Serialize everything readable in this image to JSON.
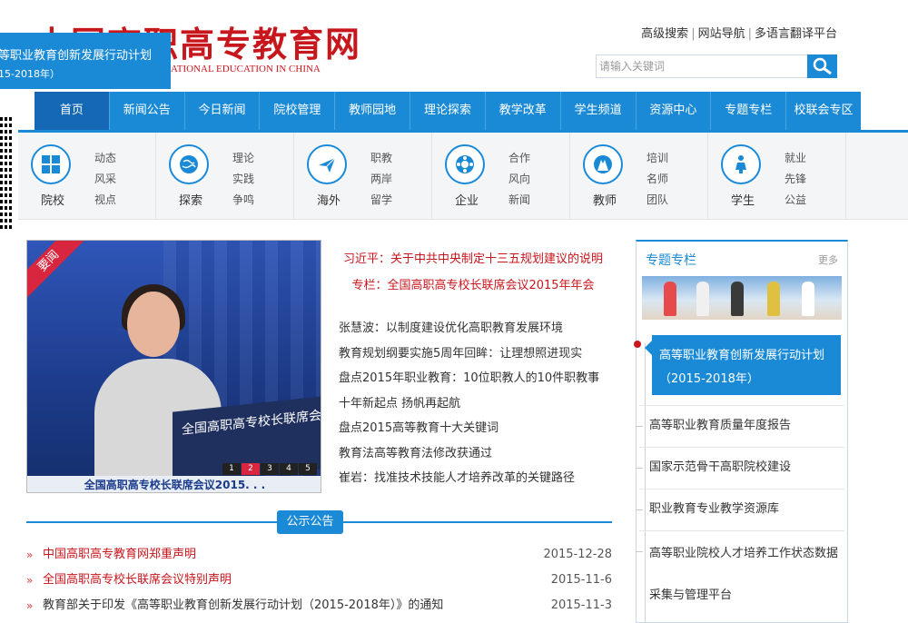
{
  "header": {
    "logo_cn": "中国高职高专教育网",
    "logo_en": "ATIONAL EDUCATION IN CHINA",
    "toplinks": [
      "高级搜索",
      "网站导航",
      "多语言翻译平台"
    ],
    "search_placeholder": "请输入关键词"
  },
  "float_banner": {
    "line1": "等职业教育创新发展行动计划",
    "line2": "15-2018年）"
  },
  "nav": [
    "首页",
    "新闻公告",
    "今日新闻",
    "院校管理",
    "教师园地",
    "理论探索",
    "教学改革",
    "学生频道",
    "资源中心",
    "专题专栏",
    "校联会专区"
  ],
  "categories": [
    {
      "name": "院校",
      "links": [
        "动态",
        "风采",
        "视点"
      ]
    },
    {
      "name": "探索",
      "links": [
        "理论",
        "实践",
        "争鸣"
      ]
    },
    {
      "name": "海外",
      "links": [
        "职教",
        "两岸",
        "留学"
      ]
    },
    {
      "name": "企业",
      "links": [
        "合作",
        "风向",
        "新闻"
      ]
    },
    {
      "name": "教师",
      "links": [
        "培训",
        "名师",
        "团队"
      ]
    },
    {
      "name": "学生",
      "links": [
        "就业",
        "先锋",
        "公益"
      ]
    }
  ],
  "slide": {
    "ribbon": "要闻",
    "podium_text": "全国高职高专校长联席会议",
    "caption": "全国高职高专校长联席会议2015. . .",
    "pages": [
      "1",
      "2",
      "3",
      "4",
      "5"
    ],
    "active_page": 2
  },
  "headlines": {
    "top1": "习近平：关于中共中央制定十三五规划建议的说明",
    "top2": "专栏：全国高职高专校长联席会议2015年年会",
    "items": [
      "张慧波：以制度建设优化高职教育发展环境",
      "教育规划纲要实施5周年回眸：让理想照进现实",
      "盘点2015年职业教育：10位职教人的10件职教事",
      "十年新起点 扬帆再起航",
      "盘点2015高等教育十大关键词",
      "教育法高等教育法修改获通过",
      "崔岩：找准技术技能人才培养改革的关键路径"
    ]
  },
  "notices": {
    "title": "公示公告",
    "items": [
      {
        "text": "中国高职高专教育网郑重声明",
        "date": "2015-12-28",
        "red": true
      },
      {
        "text": "全国高职高专校长联席会议特别声明",
        "date": "2015-11-6",
        "red": true
      },
      {
        "text": "教育部关于印发《高等职业教育创新发展行动计划（2015-2018年）》的通知",
        "date": "2015-11-3",
        "red": false
      }
    ]
  },
  "side": {
    "title": "专题专栏",
    "more": "更多",
    "active": "高等职业教育创新发展行动计划（2015-2018年）",
    "items": [
      "高等职业教育质量年度报告",
      "国家示范骨干高职院校建设",
      "职业教育专业教学资源库",
      "高等职业院校人才培养工作状态数据采集与管理平台"
    ]
  },
  "colors": {
    "brand_blue": "#1b8ad6",
    "brand_red": "#c8161d"
  }
}
